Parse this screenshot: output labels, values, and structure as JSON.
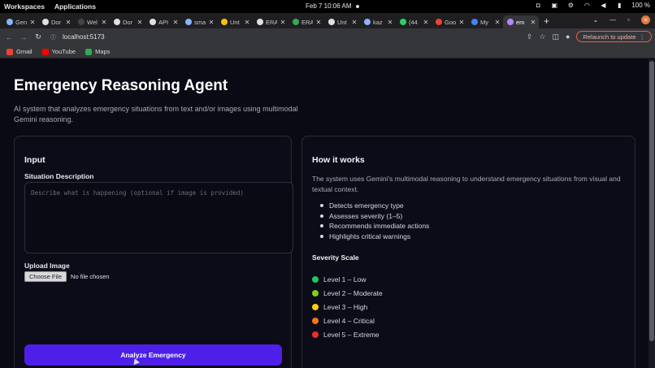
{
  "os": {
    "workspaces": "Workspaces",
    "applications": "Applications",
    "clock": "Feb 7  10:06 AM",
    "battery": "100 %"
  },
  "browser": {
    "tabs": [
      {
        "title": "Gen",
        "color": "#8ab4f8"
      },
      {
        "title": "Dor",
        "color": "#e0e0e0"
      },
      {
        "title": "Wel",
        "color": "#444"
      },
      {
        "title": "Dor",
        "color": "#e0e0e0"
      },
      {
        "title": "API",
        "color": "#e0e0e0"
      },
      {
        "title": "sma",
        "color": "#8ab4f8"
      },
      {
        "title": "Unt",
        "color": "#f4c20d"
      },
      {
        "title": "ERA",
        "color": "#e0e0e0"
      },
      {
        "title": "ERA",
        "color": "#34a853"
      },
      {
        "title": "Unt",
        "color": "#e0e0e0"
      },
      {
        "title": "kaz",
        "color": "#8ab4f8"
      },
      {
        "title": "(44",
        "color": "#25d366"
      },
      {
        "title": "Goo",
        "color": "#ea4335"
      },
      {
        "title": "My",
        "color": "#4285f4"
      },
      {
        "title": "em",
        "color": "#b388ff"
      }
    ],
    "url": "localhost:5173",
    "relaunch_label": "Relaunch to update",
    "bookmarks": [
      {
        "label": "Gmail",
        "color": "#ea4335"
      },
      {
        "label": "YouTube",
        "color": "#ff0000"
      },
      {
        "label": "Maps",
        "color": "#34a853"
      }
    ]
  },
  "page": {
    "title": "Emergency Reasoning Agent",
    "subtitle": "AI system that analyzes emergency situations from text and/or images using multimodal Gemini reasoning."
  },
  "input_card": {
    "heading": "Input",
    "situation_label": "Situation Description",
    "situation_placeholder": "Describe what is happening (optional if image is provided)",
    "upload_label": "Upload Image",
    "choose_file": "Choose File",
    "no_file": "No file chosen",
    "analyze_button": "Analyze Emergency"
  },
  "how_card": {
    "heading": "How it works",
    "description": "The system uses Gemini's multimodal reasoning to understand emergency situations from visual and textual context.",
    "bullets": [
      "Detects emergency type",
      "Assesses severity (1–5)",
      "Recommends immediate actions",
      "Highlights critical warnings"
    ],
    "severity_title": "Severity Scale",
    "severity_levels": [
      {
        "label": "Level 1 – Low",
        "color": "#22c55e"
      },
      {
        "label": "Level 2 – Moderate",
        "color": "#84cc16"
      },
      {
        "label": "Level 3 – High",
        "color": "#facc15"
      },
      {
        "label": "Level 4 – Critical",
        "color": "#f97316"
      },
      {
        "label": "Level 5 – Extreme",
        "color": "#ef2b2b"
      }
    ]
  }
}
